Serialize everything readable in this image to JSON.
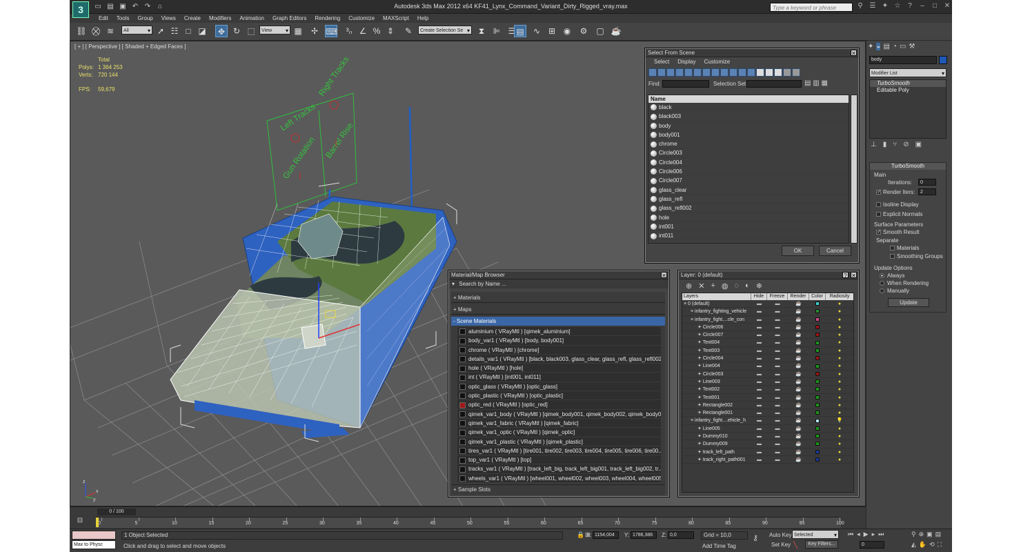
{
  "app": {
    "title": "Autodesk 3ds Max  2012 x64     KF41_Lynx_Command_Variant_Dirty_Rigged_vray.max",
    "logo": "3",
    "search_placeholder": "Type a keyword or phrase"
  },
  "menus": [
    "Edit",
    "Tools",
    "Group",
    "Views",
    "Create",
    "Modifiers",
    "Animation",
    "Graph Editors",
    "Rendering",
    "Customize",
    "MAXScript",
    "Help"
  ],
  "toolbar": {
    "selection_filter": "All",
    "ref_coord": "View",
    "named_selection": "Create Selection Se"
  },
  "viewport": {
    "label": "[ + ] [ Perspective ] [ Shaded + Edged Faces ]",
    "stats": {
      "total_label": "Total",
      "polys_label": "Polys:",
      "polys_value": "1 364 253",
      "verts_label": "Verts:",
      "verts_value": "720 144",
      "fps_label": "FPS:",
      "fps_value": "59,679"
    },
    "board_texts": [
      "Left Tracks",
      "Right Tracks",
      "Gun Rotation",
      "Barrel Rise"
    ],
    "axis_x": "x",
    "axis_y": "y",
    "axis_z": "z"
  },
  "select_from_scene": {
    "title": "Select From Scene",
    "menus": [
      "Select",
      "Display",
      "Customize"
    ],
    "find_label": "Find:",
    "selection_set_label": "Selection Set:",
    "column_name": "Name",
    "items": [
      "black",
      "black003",
      "body",
      "body001",
      "chrome",
      "Circle003",
      "Circle004",
      "Circle006",
      "Circle007",
      "glass_clear",
      "glass_refl",
      "glass_refl002",
      "hole",
      "int001",
      "int011"
    ],
    "ok": "OK",
    "cancel": "Cancel"
  },
  "material_browser": {
    "title": "Material/Map Browser",
    "search_placeholder": "Search by Name ...",
    "sections": {
      "materials": "+ Materials",
      "maps": "+ Maps",
      "scene_materials": "- Scene Materials",
      "sample_slots": "+ Sample Slots"
    },
    "items": [
      "aluminium  ( VRayMtl )  [qimek_aluminium]",
      "body_var1  ( VRayMtl )  [body, body001]",
      "chrome  ( VRayMtl )  [chrome]",
      "details_var1  ( VRayMtl )  [black, black003, glass_clear, glass_refl, glass_refl002]",
      "hole  ( VRayMtl )  [hole]",
      "int  ( VRayMtl )  [int001, int011]",
      "optic_glass  ( VRayMtl )  [optic_glass]",
      "optic_plastic  ( VRayMtl )  [optic_plastic]",
      "optic_red  ( VRayMtl )  [optic_red]",
      "qimek_var1_body  ( VRayMtl )  [qimek_body001, qimek_body002, qimek_body00...",
      "qimek_var1_fabric  ( VRayMtl )  [qimek_fabric]",
      "qimek_var1_optic  ( VRayMtl )  [qimek_optic]",
      "qimek_var1_plastic  ( VRayMtl )  [qimek_plastic]",
      "tires_var1  ( VRayMtl )  [tire001, tire002, tire003, tire004, tire005, tire006, tire00...",
      "top_var1  ( VRayMtl )  [top]",
      "tracks_var1  ( VRayMtl )  [track_left_big, track_left_big001, track_left_big002, tr...",
      "wheels_var1  ( VRayMtl )  [wheel001, wheel002, wheel003, wheel004, wheel005,..."
    ]
  },
  "layer_dialog": {
    "title": "Layer: 0 (default)",
    "columns": [
      "Layers",
      "Hide",
      "Freeze",
      "Render",
      "Color",
      "Radiosity"
    ],
    "rows": [
      {
        "name": "0 (default)",
        "indent": 0,
        "color": "#3fcfcf"
      },
      {
        "name": "infantry_fighting_vehicle",
        "indent": 1,
        "color": "#2d8f2d"
      },
      {
        "name": "infantry_fight....cle_con",
        "indent": 1,
        "color": "#d44a8a"
      },
      {
        "name": "Circle006",
        "indent": 2,
        "color": "#9a1515"
      },
      {
        "name": "Circle007",
        "indent": 2,
        "color": "#9a1515"
      },
      {
        "name": "Text004",
        "indent": 2,
        "color": "#1a9a1a"
      },
      {
        "name": "Text003",
        "indent": 2,
        "color": "#1a9a1a"
      },
      {
        "name": "Circle004",
        "indent": 2,
        "color": "#9a1515"
      },
      {
        "name": "Line004",
        "indent": 2,
        "color": "#1a9a1a"
      },
      {
        "name": "Circle003",
        "indent": 2,
        "color": "#9a1515"
      },
      {
        "name": "Line003",
        "indent": 2,
        "color": "#1a9a1a"
      },
      {
        "name": "Text002",
        "indent": 2,
        "color": "#1a9a1a"
      },
      {
        "name": "Text001",
        "indent": 2,
        "color": "#1a9a1a"
      },
      {
        "name": "Rectangle002",
        "indent": 2,
        "color": "#1a9a1a"
      },
      {
        "name": "Rectangle001",
        "indent": 2,
        "color": "#1a9a1a"
      },
      {
        "name": "infantry_fight....ehicle_h",
        "indent": 1,
        "color": "#aee0f0"
      },
      {
        "name": "Line005",
        "indent": 2,
        "color": "#1a9a1a"
      },
      {
        "name": "Dummy010",
        "indent": 2,
        "color": "#1a9a1a"
      },
      {
        "name": "Dummy009",
        "indent": 2,
        "color": "#1a9a1a"
      },
      {
        "name": "track_left_path",
        "indent": 2,
        "color": "#1a3a9a"
      },
      {
        "name": "track_right_path001",
        "indent": 2,
        "color": "#1a3a9a"
      }
    ]
  },
  "command_panel": {
    "name_field": "body",
    "modifier_list": "Modifier List",
    "stack": [
      "TurboSmooth",
      "Editable Poly"
    ],
    "turbosmooth_title": "TurboSmooth",
    "main_label": "Main",
    "iterations_label": "Iterations:",
    "iterations_value": "0",
    "render_iters_label": "Render Iters:",
    "render_iters_value": "2",
    "isoline_label": "Isoline Display",
    "explicit_normals_label": "Explicit Normals",
    "surface_params_label": "Surface Parameters",
    "smooth_result_label": "Smooth Result",
    "separate_label": "Separate",
    "materials_label": "Materials",
    "smoothing_groups_label": "Smoothing Groups",
    "update_options_label": "Update Options",
    "always_label": "Always",
    "when_rendering_label": "When Rendering",
    "manually_label": "Manually",
    "update_button": "Update"
  },
  "timeline": {
    "frame_counter": "0 / 100",
    "ticks": [
      "0",
      "5",
      "10",
      "15",
      "20",
      "25",
      "30",
      "35",
      "40",
      "45",
      "50",
      "55",
      "60",
      "65",
      "70",
      "75",
      "80",
      "85",
      "90",
      "95",
      "100"
    ]
  },
  "status": {
    "maxscript_label": "Max to Physc",
    "selected": "1 Object Selected",
    "prompt": "Click and drag to select and move objects",
    "x_label": "X:",
    "x_value": "1154,004",
    "y_label": "Y:",
    "y_value": "1786,386",
    "z_label": "Z:",
    "z_value": "0,0",
    "grid": "Grid = 10,0",
    "add_time_tag": "Add Time Tag",
    "auto_key": "Auto Key",
    "set_key": "Set Key",
    "selected_dropdown": "Selected",
    "key_filters": "Key Filters...",
    "frame_field": "0"
  }
}
